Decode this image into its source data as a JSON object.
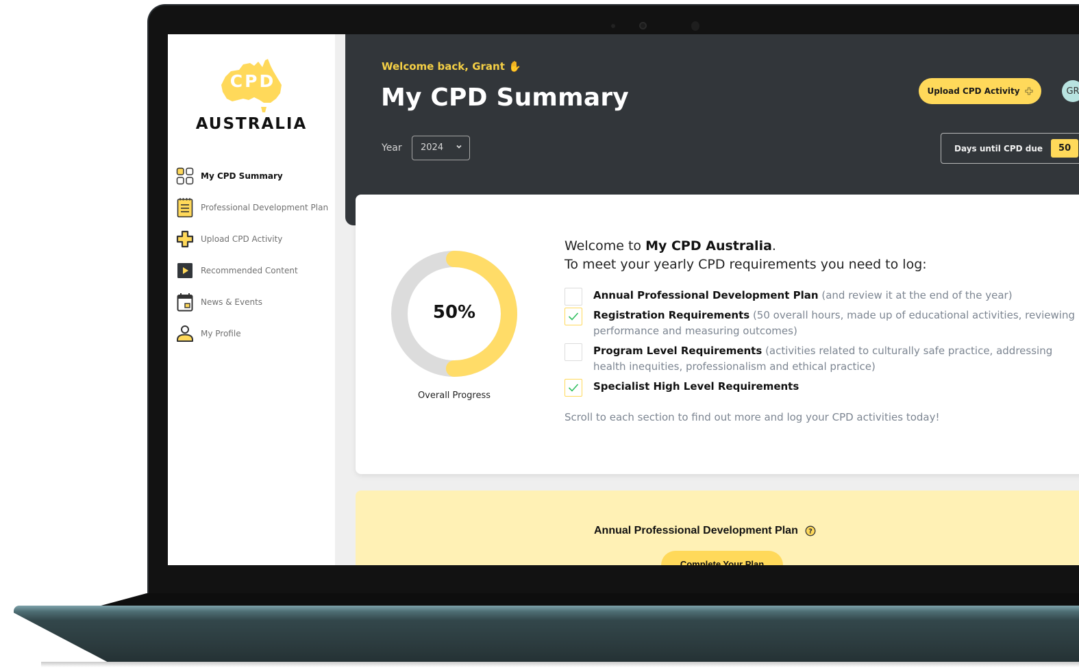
{
  "brand": {
    "logo_mark": "CPD",
    "logo_name": "AUSTRALIA",
    "accent_color": "#ffd95a",
    "dark_color": "#32363a"
  },
  "sidebar": {
    "items": [
      {
        "label": "My CPD Summary",
        "icon": "grid-icon",
        "active": true
      },
      {
        "label": "Professional Development Plan",
        "icon": "notepad-icon",
        "active": false
      },
      {
        "label": "Upload CPD Activity",
        "icon": "plus-icon",
        "active": false
      },
      {
        "label": "Recommended Content",
        "icon": "play-icon",
        "active": false
      },
      {
        "label": "News & Events",
        "icon": "calendar-icon",
        "active": false
      },
      {
        "label": "My Profile",
        "icon": "user-icon",
        "active": false
      }
    ]
  },
  "header": {
    "welcome": "Welcome back, Grant ✋",
    "title": "My CPD Summary",
    "year_label": "Year",
    "year_value": "2024",
    "upload_button": "Upload CPD Activity",
    "avatar_initials": "GR",
    "days_label": "Days until CPD due",
    "days_value": "50"
  },
  "summary": {
    "progress_percent": 50,
    "progress_label": "50%",
    "progress_caption": "Overall Progress",
    "intro_prefix": "Welcome to ",
    "intro_brand": "My CPD Australia",
    "intro_suffix": ".",
    "intro_line2": "To meet your yearly CPD requirements you need to log:",
    "requirements": [
      {
        "title": "Annual Professional Development Plan",
        "desc": "(and review it at the end of the year)",
        "checked": false
      },
      {
        "title": "Registration Requirements",
        "desc": "(50 overall hours, made up of educational activities, reviewing performance and measuring outcomes)",
        "checked": true
      },
      {
        "title": "Program Level Requirements",
        "desc": "(activities related to culturally safe practice, addressing health inequities, professionalism and ethical practice)",
        "checked": false
      },
      {
        "title": "Specialist High Level Requirements",
        "desc": "",
        "checked": true
      }
    ],
    "scroll_note": "Scroll to each section to find out more and log your CPD activities today!"
  },
  "plan_section": {
    "title": "Annual Professional Development Plan",
    "help_icon": "help-icon",
    "button": "Complete Your Plan"
  }
}
